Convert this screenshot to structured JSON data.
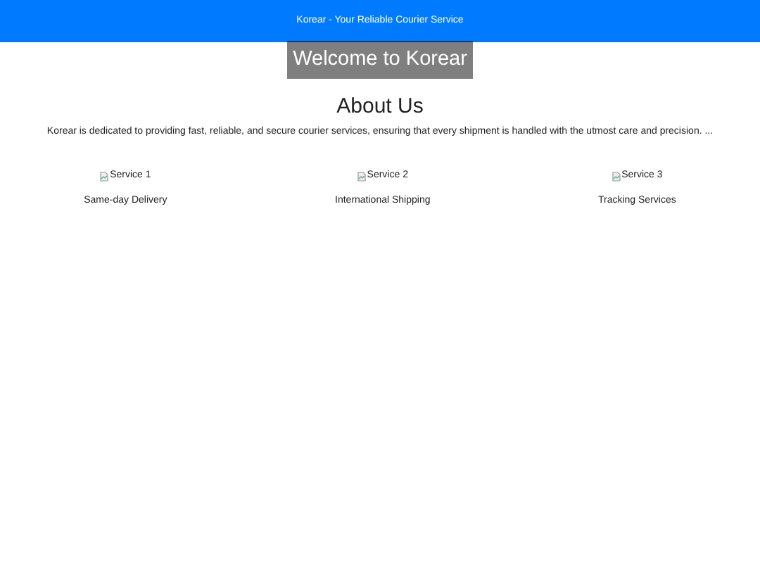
{
  "header": {
    "title": "Korear - Your Reliable Courier Service"
  },
  "hero": {
    "heading": "Welcome to Korear"
  },
  "about": {
    "heading": "About Us",
    "text": "Korear is dedicated to providing fast, reliable, and secure courier services, ensuring that every shipment is handled with the utmost care and precision. ..."
  },
  "services": [
    {
      "image_alt": "Service 1",
      "name": "Same-day Delivery"
    },
    {
      "image_alt": "Service 2",
      "name": "International Shipping"
    },
    {
      "image_alt": "Service 3",
      "name": "Tracking Services"
    }
  ]
}
